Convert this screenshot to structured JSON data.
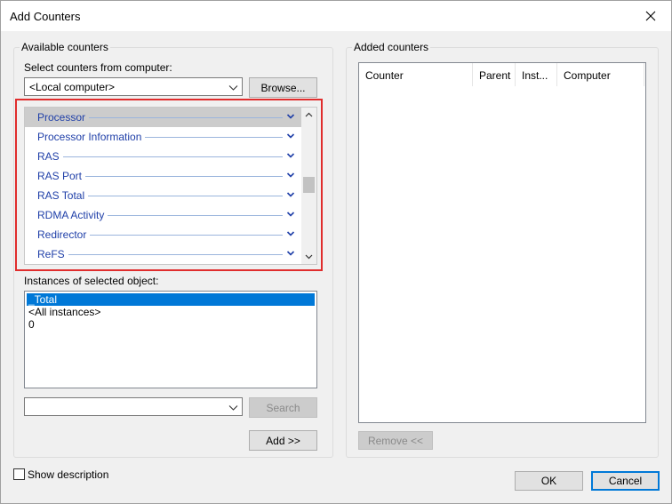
{
  "window": {
    "title": "Add Counters",
    "close_icon": "close-icon"
  },
  "available": {
    "group_label": "Available counters",
    "select_label": "Select counters from computer:",
    "computer_value": "<Local computer>",
    "browse_label": "Browse...",
    "counters": [
      {
        "label": "Processor",
        "selected": true
      },
      {
        "label": "Processor Information",
        "selected": false
      },
      {
        "label": "RAS",
        "selected": false
      },
      {
        "label": "RAS Port",
        "selected": false
      },
      {
        "label": "RAS Total",
        "selected": false
      },
      {
        "label": "RDMA Activity",
        "selected": false
      },
      {
        "label": "Redirector",
        "selected": false
      },
      {
        "label": "ReFS",
        "selected": false
      }
    ],
    "instances_label": "Instances of selected object:",
    "instances": [
      "_Total",
      "<All instances>",
      "0"
    ],
    "search_value": "",
    "search_label": "Search",
    "add_label": "Add >>"
  },
  "added": {
    "group_label": "Added counters",
    "columns": [
      "Counter",
      "Parent",
      "Inst...",
      "Computer"
    ],
    "remove_label": "Remove <<"
  },
  "footer": {
    "show_description_label": "Show description",
    "ok_label": "OK",
    "cancel_label": "Cancel"
  },
  "colors": {
    "highlight_border": "#e02d2d",
    "counter_text": "#1f3fa8",
    "selection": "#0078d7"
  }
}
